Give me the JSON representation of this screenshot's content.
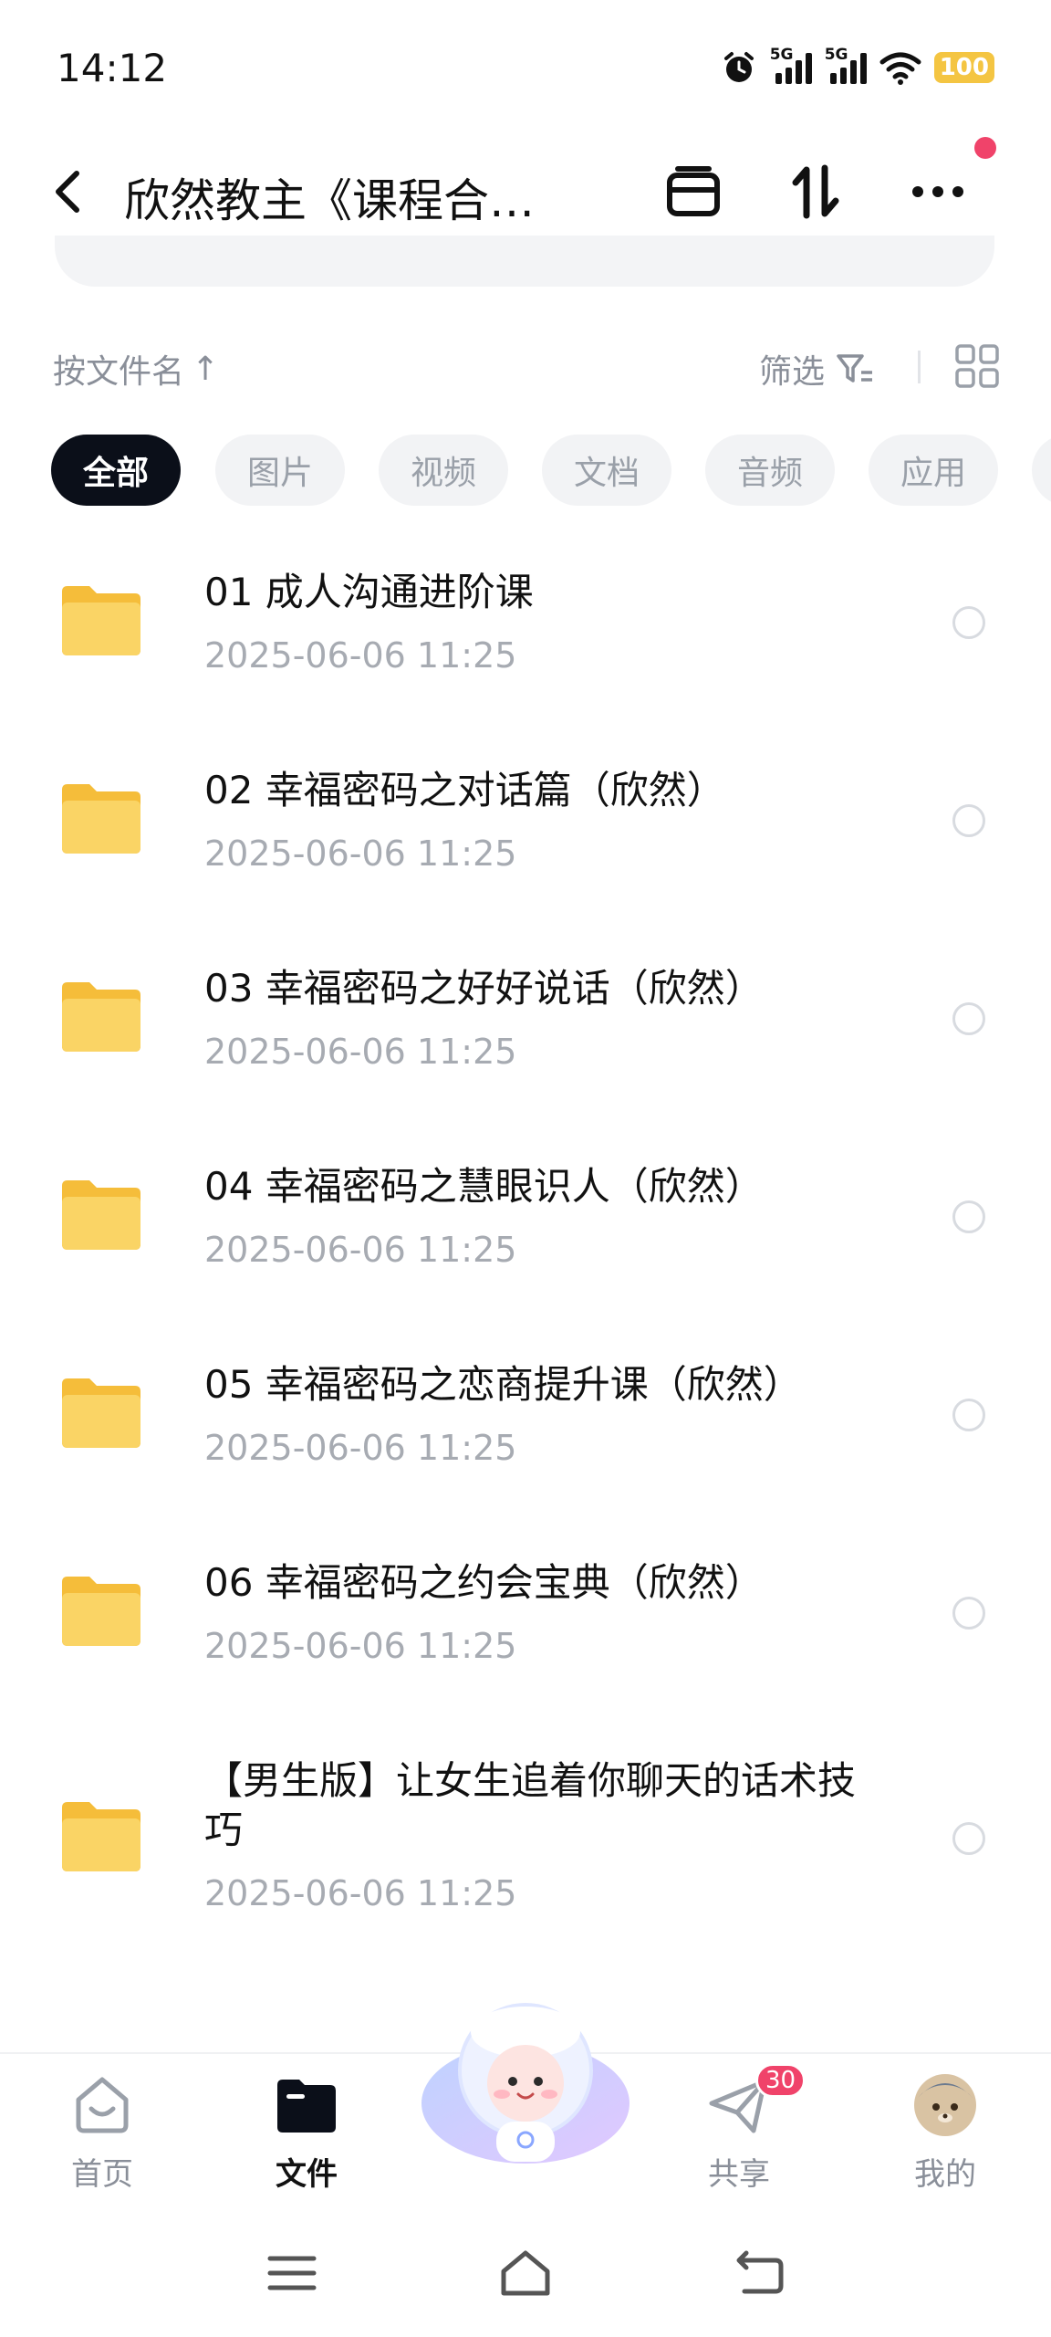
{
  "status_bar": {
    "time": "14:12",
    "network1": "5G",
    "network2": "5G",
    "battery": "100"
  },
  "header": {
    "title": "欣然教主《课程合…"
  },
  "sort": {
    "label": "按文件名",
    "arrow": "↑",
    "filter_label": "筛选"
  },
  "categories": [
    {
      "label": "全部",
      "active": true
    },
    {
      "label": "图片"
    },
    {
      "label": "视频"
    },
    {
      "label": "文档"
    },
    {
      "label": "音频"
    },
    {
      "label": "应用"
    }
  ],
  "files": [
    {
      "name": "01 成人沟通进阶课",
      "date": "2025-06-06  11:25"
    },
    {
      "name": "02 幸福密码之对话篇（欣然）",
      "date": "2025-06-06  11:25"
    },
    {
      "name": "03 幸福密码之好好说话（欣然）",
      "date": "2025-06-06  11:25"
    },
    {
      "name": "04 幸福密码之慧眼识人（欣然）",
      "date": "2025-06-06  11:25"
    },
    {
      "name": "05 幸福密码之恋商提升课（欣然）",
      "date": "2025-06-06  11:25"
    },
    {
      "name": "06 幸福密码之约会宝典（欣然）",
      "date": "2025-06-06  11:25"
    },
    {
      "name": "【男生版】让女生追着你聊天的话术技巧",
      "date": "2025-06-06  11:25"
    }
  ],
  "bottom_nav": {
    "home": "首页",
    "files": "文件",
    "share": "共享",
    "share_badge": "30",
    "mine": "我的"
  },
  "colors": {
    "accent_dark": "#0b0f19",
    "folder": "#f7c948",
    "badge": "#f0436a",
    "battery": "#f4c542"
  }
}
